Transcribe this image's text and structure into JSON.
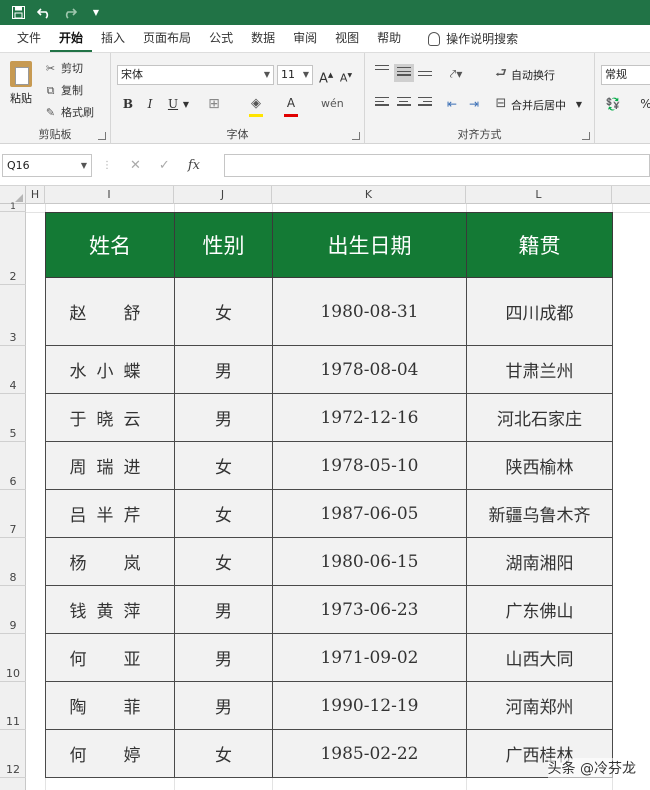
{
  "quick_access": {
    "save_icon": "save-icon",
    "undo_icon": "undo-icon",
    "redo_icon": "redo-icon",
    "customize": "▼"
  },
  "tabs": [
    "文件",
    "开始",
    "插入",
    "页面布局",
    "公式",
    "数据",
    "审阅",
    "视图",
    "帮助"
  ],
  "active_tab": "开始",
  "tell_me": "操作说明搜索",
  "ribbon": {
    "clipboard": {
      "paste": "粘贴",
      "cut": "剪切",
      "copy": "复制",
      "format_painter": "格式刷",
      "label": "剪贴板"
    },
    "font": {
      "name": "宋体",
      "size": "11",
      "label": "字体",
      "bold": "B",
      "italic": "I",
      "underline": "U"
    },
    "alignment": {
      "wrap_text": "自动换行",
      "merge_center": "合并后居中",
      "label": "对齐方式"
    },
    "number": {
      "format": "常规",
      "percent": "%"
    }
  },
  "formula_bar": {
    "name_box": "Q16",
    "fx": "fx",
    "content": ""
  },
  "columns": [
    "H",
    "I",
    "J",
    "K",
    "L"
  ],
  "rows": [
    "1",
    "2",
    "3",
    "4",
    "5",
    "6",
    "7",
    "8",
    "9",
    "10",
    "11",
    "12"
  ],
  "table": {
    "headers": [
      "姓名",
      "性别",
      "出生日期",
      "籍贯"
    ],
    "rows": [
      [
        "赵　舒",
        "女",
        "1980-08-31",
        "四川成都"
      ],
      [
        "水小蝶",
        "男",
        "1978-08-04",
        "甘肃兰州"
      ],
      [
        "于晓云",
        "男",
        "1972-12-16",
        "河北石家庄"
      ],
      [
        "周瑞进",
        "女",
        "1978-05-10",
        "陕西榆林"
      ],
      [
        "吕半芹",
        "女",
        "1987-06-05",
        "新疆乌鲁木齐"
      ],
      [
        "杨　岚",
        "女",
        "1980-06-15",
        "湖南湘阳"
      ],
      [
        "钱黄萍",
        "男",
        "1973-06-23",
        "广东佛山"
      ],
      [
        "何　亚",
        "男",
        "1971-09-02",
        "山西大同"
      ],
      [
        "陶　菲",
        "男",
        "1990-12-19",
        "河南郑州"
      ],
      [
        "何　婷",
        "女",
        "1985-02-22",
        "广西桂林"
      ]
    ]
  },
  "watermark": "头条 @冷芬龙",
  "colors": {
    "accent": "#217346",
    "header_fill": "#147a35",
    "cell_fill": "#f2f2f2"
  }
}
